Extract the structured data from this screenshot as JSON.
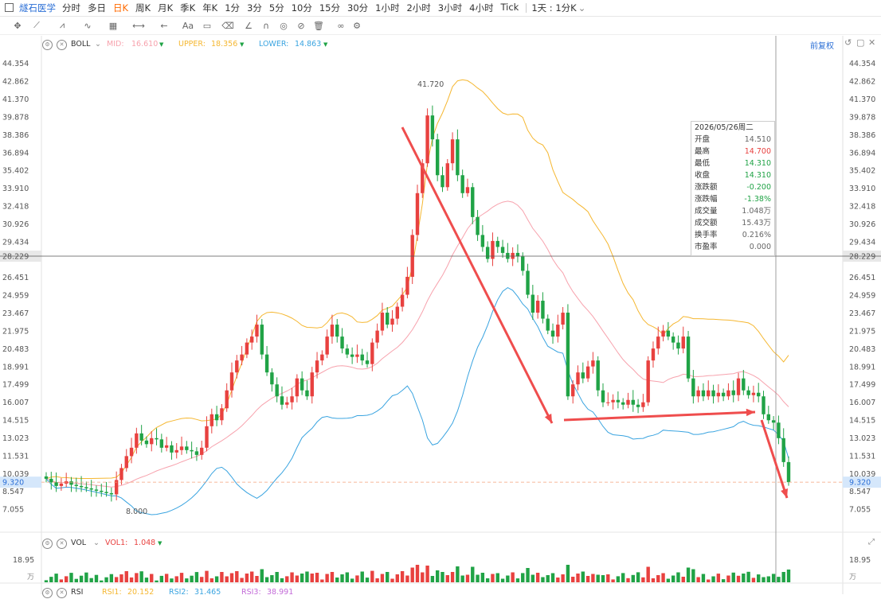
{
  "ticker": "燧石医学",
  "intervals": [
    "分时",
    "多日",
    "日K",
    "周K",
    "月K",
    "季K",
    "年K",
    "1分",
    "3分",
    "5分",
    "10分",
    "15分",
    "30分",
    "1小时",
    "2小时",
    "3小时",
    "4小时",
    "Tick"
  ],
  "active_interval": "日K",
  "timeframe_select": "1天 : 1分K",
  "boll": {
    "name": "BOLL",
    "mid_label": "MID:",
    "mid_value": "16.610",
    "upper_label": "UPPER:",
    "upper_value": "18.356",
    "lower_label": "LOWER:",
    "lower_value": "14.863"
  },
  "restore_label": "前复权",
  "vol": {
    "name": "VOL",
    "vol1_label": "VOL1:",
    "vol1_value": "1.048"
  },
  "rsi": {
    "name": "RSI",
    "rsi1_label": "RSI1:",
    "rsi1_value": "20.152",
    "rsi2_label": "RSI2:",
    "rsi2_value": "31.465",
    "rsi3_label": "RSI3:",
    "rsi3_value": "38.991"
  },
  "tooltip": {
    "date": "2026/05/26周二",
    "rows": [
      {
        "label": "开盘",
        "value": "14.510"
      },
      {
        "label": "最高",
        "value": "14.700"
      },
      {
        "label": "最低",
        "value": "14.310"
      },
      {
        "label": "收盘",
        "value": "14.310"
      },
      {
        "label": "涨跌额",
        "value": "-0.200"
      },
      {
        "label": "涨跌幅",
        "value": "-1.38%"
      },
      {
        "label": "成交量",
        "value": "1.048万"
      },
      {
        "label": "成交额",
        "value": "15.43万"
      },
      {
        "label": "换手率",
        "value": "0.216%"
      },
      {
        "label": "市盈率",
        "value": "0.000"
      }
    ]
  },
  "colors": {
    "up": "#e8413f",
    "down": "#20a346",
    "upper": "#f5b731",
    "mid": "#f7a2ad",
    "lower": "#3aa4e0",
    "blue": "#2b6fd6"
  },
  "chart_data": {
    "type": "candlestick",
    "y_ticks": [
      "44.354",
      "42.862",
      "41.370",
      "39.878",
      "38.386",
      "36.894",
      "35.402",
      "33.910",
      "32.418",
      "30.926",
      "29.434",
      "28.229",
      "26.451",
      "24.959",
      "23.467",
      "21.975",
      "20.483",
      "18.991",
      "17.499",
      "16.007",
      "14.515",
      "13.023",
      "11.531",
      "10.039",
      "9.320",
      "8.547",
      "7.055"
    ],
    "ylim": [
      6.0,
      45.0
    ],
    "crosshair_price": "28.229",
    "last_price": "9.320",
    "high_label": "41.720",
    "low_label": "8.000",
    "vol_axis": "18.95",
    "vol_unit": "万",
    "closes": [
      9.6,
      9.3,
      9.0,
      9.2,
      9.4,
      9.1,
      9.0,
      8.9,
      8.8,
      8.7,
      8.6,
      8.5,
      8.4,
      8.3,
      9.5,
      10.5,
      11.5,
      12.2,
      13.4,
      12.8,
      12.5,
      13.0,
      12.9,
      12.2,
      12.4,
      11.8,
      12.0,
      12.3,
      12.0,
      11.9,
      11.6,
      12.2,
      14.0,
      15.0,
      14.5,
      15.5,
      17.0,
      18.5,
      19.5,
      20.0,
      21.0,
      21.5,
      22.5,
      20.0,
      18.5,
      17.5,
      16.5,
      15.8,
      16.0,
      16.5,
      18.0,
      17.0,
      16.5,
      18.5,
      19.5,
      20.0,
      21.5,
      22.5,
      21.5,
      20.5,
      20.0,
      19.8,
      20.0,
      19.5,
      19.2,
      21.0,
      22.0,
      23.5,
      22.5,
      23.0,
      24.0,
      25.0,
      26.5,
      30.0,
      33.5,
      36.0,
      40.0,
      38.0,
      35.0,
      34.0,
      36.0,
      38.0,
      35.0,
      33.5,
      34.0,
      31.5,
      30.0,
      29.0,
      28.0,
      29.5,
      29.0,
      28.5,
      28.0,
      28.5,
      28.2,
      27.0,
      25.0,
      23.5,
      24.5,
      23.0,
      22.0,
      21.5,
      22.5,
      23.5,
      16.5,
      17.5,
      18.5,
      18.0,
      19.0,
      19.5,
      17.0,
      16.0,
      16.0,
      16.2,
      16.0,
      15.8,
      16.2,
      15.8,
      15.6,
      16.0,
      19.5,
      20.5,
      21.5,
      22.0,
      21.5,
      21.0,
      20.5,
      21.5,
      18.0,
      16.5,
      17.0,
      16.5,
      17.0,
      16.5,
      16.8,
      16.5,
      17.0,
      16.6,
      18.0,
      17.0,
      16.6,
      16.8,
      16.5,
      15.0,
      14.5,
      14.3,
      13.0,
      11.0,
      9.32
    ],
    "annotation_arrows": 4
  }
}
